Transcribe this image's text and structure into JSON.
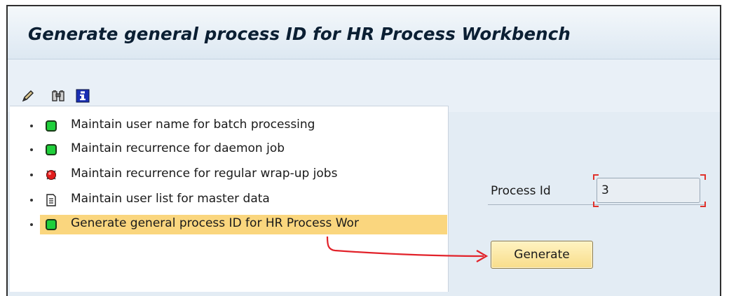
{
  "window": {
    "title": "Generate general process ID for HR Process Workbench"
  },
  "toolbar": {
    "icons": [
      "pencil-icon",
      "binoculars-icon",
      "info-icon"
    ]
  },
  "tree": {
    "items": [
      {
        "label": "Maintain user name for batch processing",
        "icon": "green-status-icon"
      },
      {
        "label": "Maintain recurrence for daemon job",
        "icon": "green-status-icon"
      },
      {
        "label": "Maintain recurrence for regular wrap-up jobs",
        "icon": "red-status-icon"
      },
      {
        "label": "Maintain user list for master data",
        "icon": "document-icon"
      },
      {
        "label": "Generate general process ID for HR Process Wor",
        "icon": "green-status-icon",
        "selected": true
      }
    ]
  },
  "form": {
    "process_id_label": "Process Id",
    "process_id_value": "3",
    "generate_label": "Generate"
  },
  "colors": {
    "selection": "#fad67e",
    "annotation_arrow": "#e2222a",
    "required_marker": "#e0322c"
  }
}
